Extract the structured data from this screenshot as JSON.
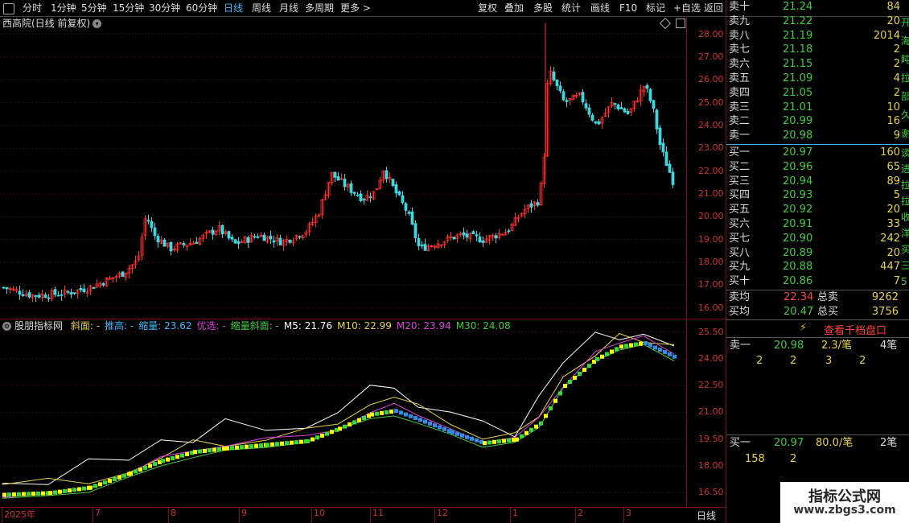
{
  "toolbar": {
    "periods": [
      "分时",
      "1分钟",
      "5分钟",
      "15分钟",
      "30分钟",
      "60分钟",
      "日线",
      "周线",
      "月线",
      "多周期",
      "更多 >"
    ],
    "active_period": "日线",
    "actions": [
      "复权",
      "叠加",
      "多股",
      "统计",
      "画线",
      "F10",
      "标记",
      "+自选",
      "返回"
    ]
  },
  "main": {
    "stock_title": "西高院(日线 前复权)",
    "y_labels": [
      "28.00",
      "27.00",
      "26.00",
      "25.00",
      "24.00",
      "23.00",
      "22.00",
      "21.00",
      "20.00",
      "19.00",
      "18.00",
      "17.00",
      "16.00"
    ],
    "ymin": 15.5,
    "ymax": 28.8
  },
  "indicator": {
    "name": "股朋指标网",
    "items": [
      {
        "text": "斜面: -",
        "color": "#e6d24a"
      },
      {
        "text": "推高: -",
        "color": "#3fb8ff"
      },
      {
        "text": "缩量: 23.62",
        "color": "#3fb8ff"
      },
      {
        "text": "优选: -",
        "color": "#e040e0"
      },
      {
        "text": "缩量斜面: -",
        "color": "#3fcc3f"
      },
      {
        "text": "M5: 21.76",
        "color": "#ffffff"
      },
      {
        "text": "M10: 22.99",
        "color": "#e6d24a"
      },
      {
        "text": "M20: 23.94",
        "color": "#e040e0"
      },
      {
        "text": "M30: 24.08",
        "color": "#3fcc3f"
      }
    ],
    "y_labels": [
      "25.50",
      "24.00",
      "22.50",
      "21.00",
      "19.50",
      "18.00",
      "16.50"
    ],
    "ymin": 15.7,
    "ymax": 26.2
  },
  "date_axis": {
    "labels": [
      "2025年",
      "7",
      "8",
      "9",
      "10",
      "11",
      "12",
      "1",
      "2",
      "3"
    ],
    "period_label": "日线"
  },
  "orderbook": {
    "asks": [
      {
        "label": "卖十",
        "price": "21.24",
        "qty": "84"
      },
      {
        "label": "卖九",
        "price": "21.22",
        "qty": "20"
      },
      {
        "label": "卖八",
        "price": "21.19",
        "qty": "2014"
      },
      {
        "label": "卖七",
        "price": "21.18",
        "qty": "2"
      },
      {
        "label": "卖六",
        "price": "21.15",
        "qty": "2"
      },
      {
        "label": "卖五",
        "price": "21.09",
        "qty": "4"
      },
      {
        "label": "卖四",
        "price": "21.05",
        "qty": "2"
      },
      {
        "label": "卖三",
        "price": "21.01",
        "qty": "10"
      },
      {
        "label": "卖二",
        "price": "20.99",
        "qty": "16"
      },
      {
        "label": "卖一",
        "price": "20.98",
        "qty": "9"
      }
    ],
    "bids": [
      {
        "label": "买一",
        "price": "20.97",
        "qty": "160"
      },
      {
        "label": "买二",
        "price": "20.96",
        "qty": "65"
      },
      {
        "label": "买三",
        "price": "20.94",
        "qty": "89"
      },
      {
        "label": "买四",
        "price": "20.93",
        "qty": "5"
      },
      {
        "label": "买五",
        "price": "20.92",
        "qty": "20"
      },
      {
        "label": "买六",
        "price": "20.91",
        "qty": "33"
      },
      {
        "label": "买七",
        "price": "20.90",
        "qty": "242"
      },
      {
        "label": "买八",
        "price": "20.89",
        "qty": "20"
      },
      {
        "label": "买九",
        "price": "20.88",
        "qty": "447"
      },
      {
        "label": "买十",
        "price": "20.86",
        "qty": "7"
      }
    ],
    "sell_avg_label": "卖均",
    "sell_avg": "22.34",
    "total_sell_label": "总卖",
    "total_sell": "9262",
    "buy_avg_label": "买均",
    "buy_avg": "20.47",
    "total_buy_label": "总买",
    "total_buy": "3756",
    "view_button": "查看千档盘口",
    "side_chars_top": [
      "开",
      "海",
      "盹",
      "拉",
      "部",
      "久",
      "谢"
    ],
    "side_chars_bottom": [
      "谈",
      "进",
      "拉",
      "拉",
      "收",
      "洋",
      "买",
      "三",
      "5"
    ]
  },
  "level2": {
    "sell1_label": "卖一",
    "sell1_price": "20.98",
    "sell1_vol": "2.3/笔",
    "sell1_count": "4笔",
    "sell1_queue": [
      "2",
      "2",
      "3",
      "2"
    ],
    "buy1_label": "买一",
    "buy1_price": "20.97",
    "buy1_vol": "80.0/笔",
    "buy1_count": "2笔",
    "buy1_queue": [
      "158",
      "2"
    ]
  },
  "watermark": {
    "line1": "指标公式网",
    "line2": "www.zbgs3.com"
  },
  "colors": {
    "up": "#ff3030",
    "down": "#3fd6e0",
    "grid": "#7a1010",
    "accent": "#3fb8ff"
  }
}
